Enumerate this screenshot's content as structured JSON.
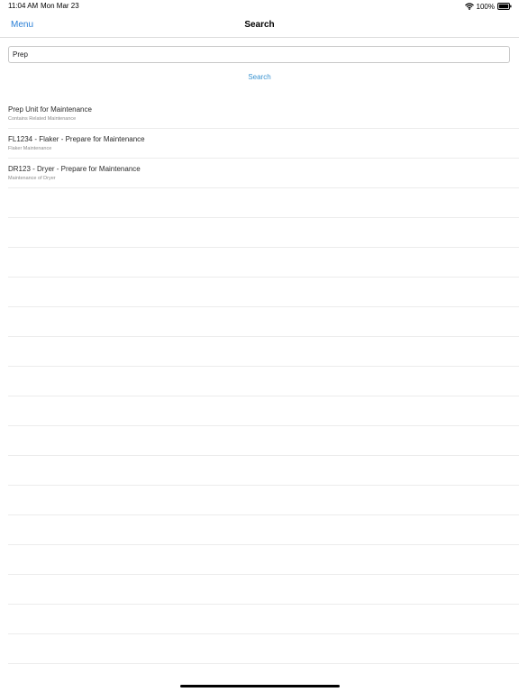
{
  "status_bar": {
    "time": "11:04 AM",
    "date": "Mon Mar 23",
    "battery": "100%",
    "wifi_icon": "wifi-icon",
    "battery_icon": "battery-icon"
  },
  "nav": {
    "menu_label": "Menu",
    "title": "Search"
  },
  "search": {
    "value": "Prep",
    "button_label": "Search"
  },
  "results": [
    {
      "title": "Prep Unit for Maintenance",
      "subtitle": "Contains Related Maintenance"
    },
    {
      "title": "FL1234 - Flaker - Prepare for Maintenance",
      "subtitle": "Flaker Maintenance"
    },
    {
      "title": "DR123 - Dryer - Prepare for Maintenance",
      "subtitle": "Maintenance of Dryer"
    }
  ],
  "colors": {
    "accent": "#2a7fd6",
    "link": "#3a93d0",
    "separator": "#ececec"
  }
}
